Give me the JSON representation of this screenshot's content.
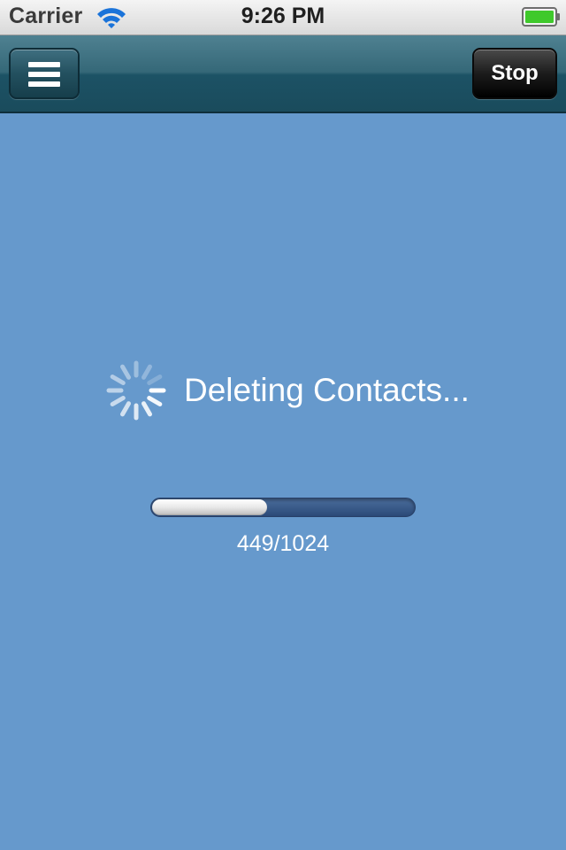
{
  "status_bar": {
    "carrier": "Carrier",
    "time": "9:26 PM",
    "wifi_icon": "wifi-icon",
    "battery_icon": "battery-full-icon",
    "battery_color": "#3fc92b"
  },
  "nav_bar": {
    "menu_icon": "hamburger-menu-icon",
    "stop_label": "Stop"
  },
  "content": {
    "spinner_icon": "activity-spinner-icon",
    "message": "Deleting Contacts...",
    "progress": {
      "current": 449,
      "total": 1024,
      "label": "449/1024"
    }
  },
  "colors": {
    "background": "#6699CC",
    "nav_bar": "#1c5265",
    "stop_button": "#000000",
    "progress_track": "#2b4a78"
  }
}
